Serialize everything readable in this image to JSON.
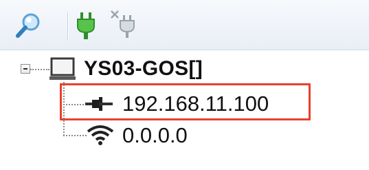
{
  "toolbar": {
    "buttons": [
      {
        "name": "search",
        "icon": "magnifier-icon"
      },
      {
        "name": "connect",
        "icon": "plug-connect-icon"
      },
      {
        "name": "disconnect",
        "icon": "plug-disconnect-icon"
      }
    ]
  },
  "tree": {
    "root": {
      "label": "YS03-GOS[]",
      "icon": "computer-monitor-icon",
      "expanded": true
    },
    "children": [
      {
        "label": "192.168.11.100",
        "icon": "wired-network-icon",
        "highlighted": true
      },
      {
        "label": "0.0.0.0",
        "icon": "wifi-icon",
        "highlighted": false
      }
    ]
  },
  "colors": {
    "highlight_border": "#e8412c",
    "toolbar_top": "#f7f9fc",
    "toolbar_bottom": "#e9eef6"
  }
}
